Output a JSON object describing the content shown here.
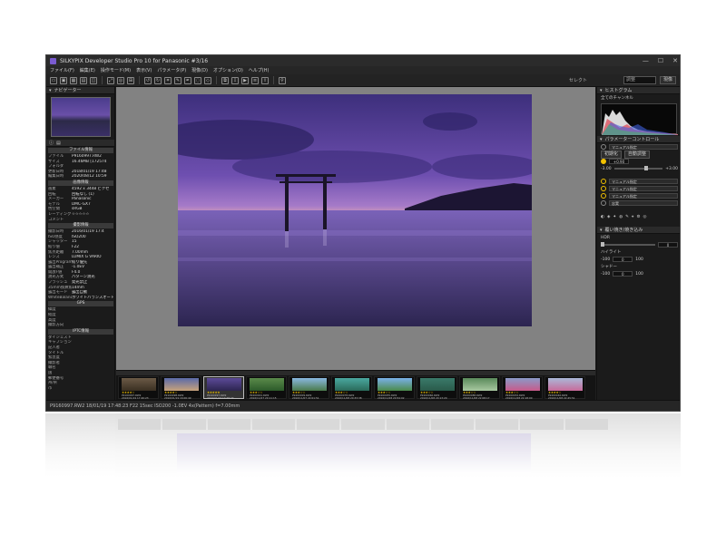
{
  "window": {
    "title": "SILKYPIX Developer Studio Pro 10 for Panasonic   #3/16",
    "controls": [
      "—",
      "☐",
      "✕"
    ]
  },
  "menu": [
    "ファイル(F)",
    "編集(E)",
    "操作モード(M)",
    "表示(V)",
    "パラメータ(P)",
    "現像(D)",
    "オプション(O)",
    "ヘルプ(H)"
  ],
  "toolbar": {
    "search_placeholder": "調整",
    "right_button": "現像",
    "select_label": "セレクト"
  },
  "navigator": {
    "title": "ナビゲーター"
  },
  "info": {
    "file_section": "ファイル情報",
    "file_rows": [
      {
        "k": "ファイル",
        "v": "P9160997.RW2"
      },
      {
        "k": "サイズ",
        "v": "16.46MB [172574"
      },
      {
        "k": "フォルダ",
        "v": ""
      },
      {
        "k": "更新日時",
        "v": "2018/01/19 17:48"
      },
      {
        "k": "編集日時",
        "v": "2020/08/12 10:59"
      }
    ],
    "image_section": "画像情報",
    "image_rows": [
      {
        "k": "画素",
        "v": "4592 x 3448 ピクセ"
      },
      {
        "k": "回転",
        "v": "回転なし (1)"
      },
      {
        "k": "メーカー",
        "v": "Panasonic"
      },
      {
        "k": "モデル",
        "v": "DMC-GX7"
      },
      {
        "k": "色空間",
        "v": "sRGB"
      },
      {
        "k": "レーティング",
        "v": "☆☆☆☆☆"
      },
      {
        "k": "コメント",
        "v": ""
      }
    ],
    "shoot_section": "撮影情報",
    "shoot_rows": [
      {
        "k": "撮影日時",
        "v": "2016/01/19 17:4"
      },
      {
        "k": "ISO感度",
        "v": "ISO200"
      },
      {
        "k": "シャッター",
        "v": "15"
      },
      {
        "k": "絞り値",
        "v": "F22"
      },
      {
        "k": "焦点距離",
        "v": "7.00mm"
      },
      {
        "k": "レンズ",
        "v": "LUMIX G VARIO"
      },
      {
        "k": "露出Program",
        "v": "絞り優先"
      },
      {
        "k": "露出補正",
        "v": "-1.0EV"
      },
      {
        "k": "開放F値",
        "v": "F4.0"
      },
      {
        "k": "測光方式",
        "v": "パターン測光"
      },
      {
        "k": "フラッシュ",
        "v": "発光禁止"
      },
      {
        "k": "35mm換算焦点",
        "v": "14mm"
      },
      {
        "k": "露出モード",
        "v": "露出自動"
      },
      {
        "k": "WhiteBalance",
        "v": "ホワイトバランスオートマニュアル"
      }
    ],
    "gps_section": "GPS",
    "gps_rows": [
      {
        "k": "緯度",
        "v": ""
      },
      {
        "k": "経度",
        "v": ""
      },
      {
        "k": "高度",
        "v": ""
      },
      {
        "k": "撮影方向",
        "v": ""
      }
    ],
    "iptc_section": "IPTC情報",
    "iptc_rows": [
      {
        "k": "ダイジェスト",
        "v": ""
      },
      {
        "k": "キャプション",
        "v": ""
      },
      {
        "k": "記入者",
        "v": ""
      },
      {
        "k": "タイトル",
        "v": ""
      },
      {
        "k": "緊急度",
        "v": ""
      },
      {
        "k": "撮影者",
        "v": ""
      },
      {
        "k": "職名",
        "v": ""
      },
      {
        "k": "国",
        "v": ""
      },
      {
        "k": "郵便番号",
        "v": ""
      },
      {
        "k": "州/県",
        "v": ""
      },
      {
        "k": "市",
        "v": ""
      }
    ]
  },
  "filmstrip": [
    {
      "file": "P9160997.RW2",
      "date": "2016/01/19 17:40:23",
      "exif": "F5.6 1/60 ISO800",
      "stars": "★★★★☆",
      "selected": false
    },
    {
      "file": "P9160998.RW2",
      "date": "2016/01/19 16:06:49",
      "exif": "F4.0 1/400 ISO200",
      "stars": "★★★★☆",
      "selected": false
    },
    {
      "file": "P9160997.RW2",
      "date": "2016/01/19 17:48:23",
      "exif": "F22 15sec ISO200",
      "stars": "★★★★★",
      "selected": true
    },
    {
      "file": "P9260001.RW2",
      "date": "2016/11/07 20:11:15",
      "exif": "F7.1 1/500 ISO800",
      "stars": "★★★☆☆",
      "selected": false
    },
    {
      "file": "P9260009.RW2",
      "date": "2016/11/07 22:01:51",
      "exif": "F5.3 1/400 ISO800",
      "stars": "★★★☆☆",
      "selected": false
    },
    {
      "file": "P9260078.RW2",
      "date": "2016/11/08 20:33:38",
      "exif": "F6.3 1/40 ISO200",
      "stars": "★★★☆☆",
      "selected": false
    },
    {
      "file": "P9260055.RW2",
      "date": "2016/11/08 20:54:02",
      "exif": "F5.6 1/40 ISO200",
      "stars": "★★★☆☆",
      "selected": false
    },
    {
      "file": "P9260066.RW2",
      "date": "2016/11/08 20:13:20",
      "exif": "F5.6 1/400 ISO200",
      "stars": "★★★☆☆",
      "selected": false
    },
    {
      "file": "P9260088.RW2",
      "date": "2016/11/08 22:08:17",
      "exif": "F5.6 1/400 ISO200",
      "stars": "★★★☆☆",
      "selected": false
    },
    {
      "file": "P9260032.RW2",
      "date": "2016/11/08 22:18:00",
      "exif": "F5.6 1/250 ISO200",
      "stars": "★★★☆☆",
      "selected": false
    },
    {
      "file": "P9260046.RW2",
      "date": "2016/11/08 22:45:51",
      "exif": "F5.6 1/1000 ISO200",
      "stars": "★★★★☆",
      "selected": false
    }
  ],
  "right_panel": {
    "histogram_title": "ヒストグラム",
    "histogram_mode": "全てのチャンネル",
    "param_title": "パラメーターコントロール",
    "taste": "マニュアル指定",
    "btn_initial": "初期化",
    "btn_auto": "自動調整",
    "exposure_value": "+0.90",
    "exposure_min": "-3.00",
    "exposure_max": "+3.00",
    "dd_wb": "マニュアル指定",
    "dd_tone": "マニュアル指定",
    "dd_color": "マニュアル指定",
    "dd_std": "忠実",
    "hdr_title": "覆い焼き/焼き込み",
    "hdr_label": "HDR",
    "hdr_value": "0",
    "highlight_label": "ハイライト",
    "highlight_min": "-100",
    "highlight_value": "0",
    "highlight_max": "100",
    "shadow_label": "シャドー",
    "shadow_min": "-100",
    "shadow_value": "0",
    "shadow_max": "100"
  },
  "status": "P9160997.RW2 18/01/19 17:48:23 F22 15sec ISO200 -1.0EV 4x(Pattern) f=7.00mm",
  "colors": {
    "accent": "#7a5bd0",
    "window_bg": "#1e1e1e",
    "canvas": "#828282",
    "star": "#f2c200"
  }
}
